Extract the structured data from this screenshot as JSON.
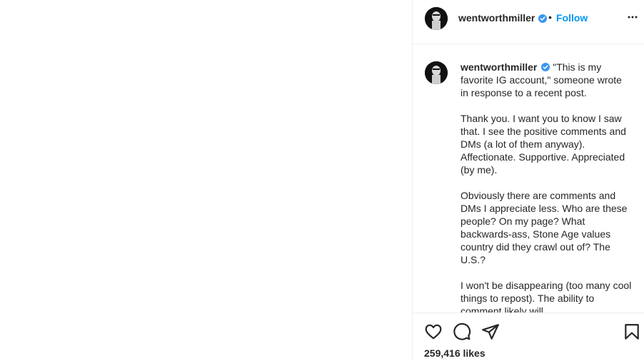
{
  "header": {
    "username": "wentworthmiller",
    "separator": "•",
    "follow_label": "Follow"
  },
  "caption": {
    "username": "wentworthmiller",
    "text": "\"This is my favorite IG account,\" someone wrote in response to a recent post.\n\nThank you. I want you to know I saw that. I see the positive comments and DMs (a lot of them anyway). Affectionate. Supportive. Appreciated (by me).\n\nObviously there are comments and DMs I appreciate less. Who are these people? On my page? What backwards-ass, Stone Age values country did they crawl out of? The U.S.?\n\nI won't be disappearing (too many cool things to repost). The ability to comment likely will."
  },
  "actions": {
    "like_icon": "heart-icon",
    "comment_icon": "comment-icon",
    "share_icon": "paper-plane-icon",
    "save_icon": "bookmark-icon"
  },
  "likes": "259,416 likes",
  "colors": {
    "accent": "#0095f6",
    "text": "#262626",
    "divider": "#efefef"
  }
}
